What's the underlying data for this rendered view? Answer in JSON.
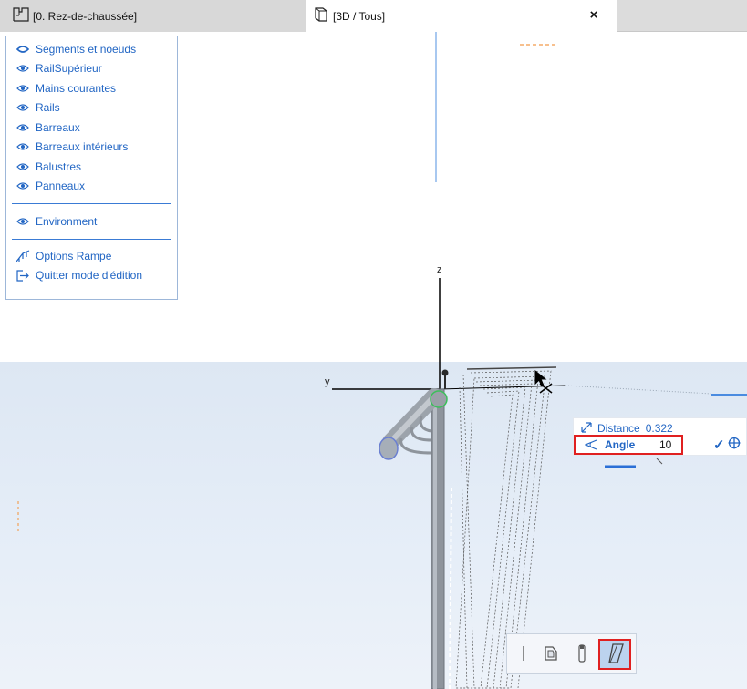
{
  "tabs": [
    {
      "label": "[0. Rez-de-chaussée]",
      "icon": "floor-plan-icon"
    },
    {
      "label": "[3D / Tous]",
      "icon": "3d-view-icon",
      "close": "×"
    }
  ],
  "layers": [
    {
      "label": "Segments et noeuds",
      "icon": "eye-solid-icon"
    },
    {
      "label": "RailSupérieur",
      "icon": "eye-icon"
    },
    {
      "label": "Mains courantes",
      "icon": "eye-icon"
    },
    {
      "label": "Rails",
      "icon": "eye-icon"
    },
    {
      "label": "Barreaux",
      "icon": "eye-icon"
    },
    {
      "label": "Barreaux intérieurs",
      "icon": "eye-icon"
    },
    {
      "label": "Balustres",
      "icon": "eye-icon"
    },
    {
      "label": "Panneaux",
      "icon": "eye-icon"
    }
  ],
  "environment": {
    "label": "Environment",
    "icon": "eye-icon"
  },
  "commands": [
    {
      "label": "Options Rampe",
      "icon": "railing-options-icon"
    },
    {
      "label": "Quitter mode d'édition",
      "icon": "exit-edit-icon"
    }
  ],
  "axes": {
    "z": "z",
    "y": "y"
  },
  "tracker": {
    "distance_label": "Distance",
    "distance_value": "0.322",
    "angle_label": "Angle",
    "angle_value": "10",
    "ok_symbol": "✓"
  },
  "pet_palette": [
    {
      "name": "vertical-line-icon",
      "active": false
    },
    {
      "name": "hinge-icon",
      "active": false
    },
    {
      "name": "post-icon",
      "active": false
    },
    {
      "name": "slant-icon",
      "active": true
    }
  ],
  "colors": {
    "accent": "#2266c4",
    "highlight": "#e02020",
    "ground": "#e3ecf7"
  }
}
